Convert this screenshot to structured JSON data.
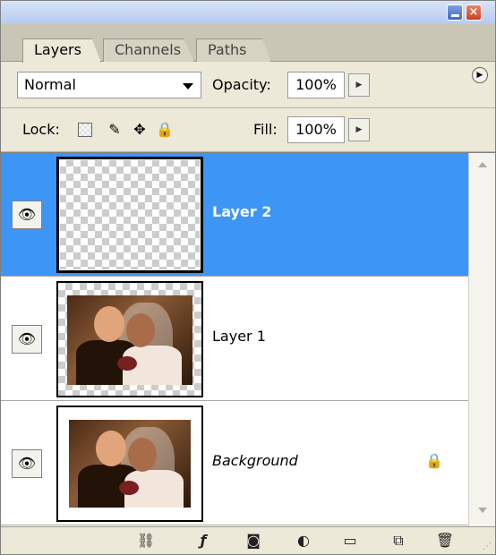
{
  "window": {
    "minimize_icon": "minimize-icon",
    "close_glyph": "×"
  },
  "tabs": [
    {
      "label": "Layers",
      "active": true
    },
    {
      "label": "Channels",
      "active": false
    },
    {
      "label": "Paths",
      "active": false
    }
  ],
  "panel_menu_glyph": "▶",
  "blend_mode": {
    "value": "Normal"
  },
  "opacity": {
    "label": "Opacity:",
    "value": "100%"
  },
  "lock": {
    "label": "Lock:"
  },
  "fill": {
    "label": "Fill:",
    "value": "100%"
  },
  "layers": [
    {
      "name": "Layer 2",
      "selected": true,
      "visible": true,
      "thumbnail": "transparent"
    },
    {
      "name": "Layer 1",
      "selected": false,
      "visible": true,
      "thumbnail": "wedding-photo-transparent-border"
    },
    {
      "name": "Background",
      "selected": false,
      "visible": true,
      "locked": true,
      "thumbnail": "wedding-photo-white-border"
    }
  ],
  "glyphs": {
    "eye": "👁",
    "brush": "✎",
    "move": "✥",
    "lock": "🔒",
    "padlock": "🔒",
    "link": "⛓",
    "fx": "ƒ",
    "mask": "◙",
    "adjust": "◐",
    "folder": "▭",
    "new": "⧉",
    "trash": "🗑",
    "arrow": "▶",
    "grip": "⋰"
  },
  "colors": {
    "selection": "#3d95f5",
    "panel_bg": "#ece9d8"
  }
}
